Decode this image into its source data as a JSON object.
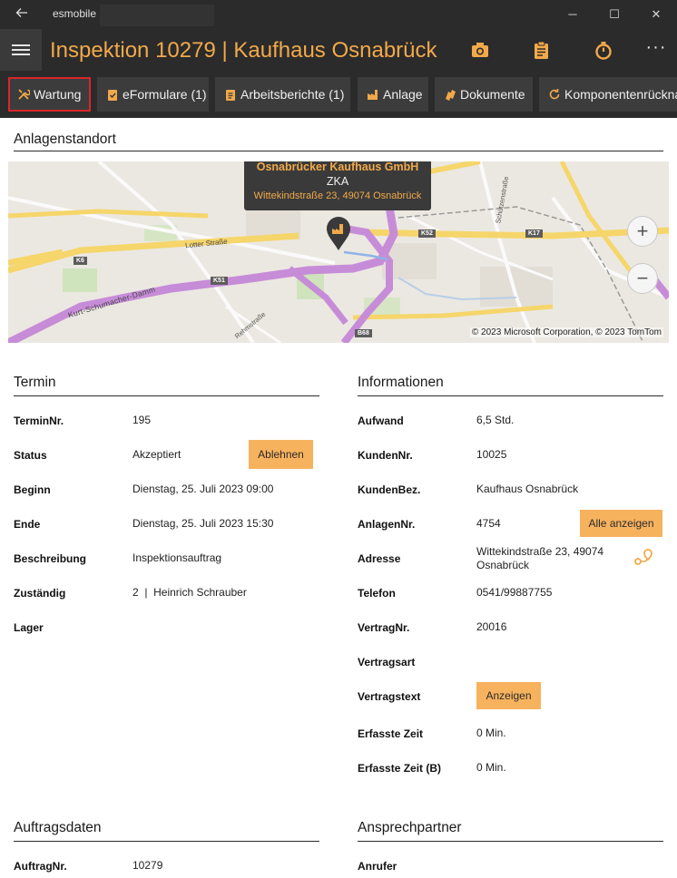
{
  "window": {
    "app_name": "esmobile",
    "back_icon": "back-arrow-icon",
    "minimize": "─",
    "maximize": "☐",
    "close": "✕"
  },
  "appbar": {
    "title": "Inspektion 10279  |  Kaufhaus Osnabrück",
    "icons": [
      "camera-icon",
      "clipboard-icon",
      "stopwatch-icon",
      "more-icon"
    ],
    "more_label": "···",
    "accent": "#f2a94a"
  },
  "toolbar": {
    "tabs": [
      {
        "label": "Wartung",
        "icon": "wrench-icon",
        "active": true
      },
      {
        "label": "eFormulare (1)",
        "icon": "clipboard-check-icon"
      },
      {
        "label": "Arbeitsberichte (1)",
        "icon": "clipboard-icon"
      },
      {
        "label": "Anlage",
        "icon": "factory-icon"
      },
      {
        "label": "Dokumente",
        "icon": "documents-icon"
      },
      {
        "label": "Komponentenrücknahme",
        "icon": "refresh-icon"
      }
    ]
  },
  "location": {
    "title": "Anlagenstandort",
    "map": {
      "popup_name": "Osnabrücker Kaufhaus GmbH",
      "popup_type": "ZKA",
      "popup_address": "Wittekindstraße 23, 49074 Osnabrück",
      "copyright": "© 2023 Microsoft Corporation, © 2023 TomTom",
      "zoom_in": "+",
      "zoom_out": "−",
      "roads": [
        "Lotter Straße",
        "Kurt-Schumacher-Damm",
        "Rehmstraße",
        "Schützenstraße"
      ],
      "shields": [
        "K6",
        "K51",
        "K52",
        "K17",
        "B68"
      ]
    }
  },
  "termin": {
    "title": "Termin",
    "rows": [
      {
        "label": "TerminNr.",
        "value": "195"
      },
      {
        "label": "Status",
        "value": "Akzeptiert",
        "button": "Ablehnen"
      },
      {
        "label": "Beginn",
        "value": "Dienstag, 25. Juli 2023 09:00"
      },
      {
        "label": "Ende",
        "value": "Dienstag, 25. Juli 2023 15:30"
      },
      {
        "label": "Beschreibung",
        "value": "Inspektionsauftrag"
      },
      {
        "label": "Zuständig",
        "value": "2  |  Heinrich Schrauber"
      },
      {
        "label": "Lager",
        "value": ""
      }
    ]
  },
  "informationen": {
    "title": "Informationen",
    "rows": [
      {
        "label": "Aufwand",
        "value": "6,5 Std."
      },
      {
        "label": "KundenNr.",
        "value": "10025"
      },
      {
        "label": "KundenBez.",
        "value": "Kaufhaus Osnabrück"
      },
      {
        "label": "AnlagenNr.",
        "value": "4754",
        "button": "Alle anzeigen"
      },
      {
        "label": "Adresse",
        "value_line1": "Wittekindstraße 23, 49074",
        "value_line2": "Osnabrück",
        "icon": "route-icon"
      },
      {
        "label": "Telefon",
        "value": "0541/99887755"
      },
      {
        "label": "VertragNr.",
        "value": "20016"
      },
      {
        "label": "Vertragsart",
        "value": ""
      },
      {
        "label": "Vertragstext",
        "value": "",
        "button": "Anzeigen"
      },
      {
        "label": "Erfasste Zeit",
        "value": "0 Min."
      },
      {
        "label": "Erfasste Zeit (B)",
        "value": "0 Min."
      }
    ]
  },
  "auftragsdaten": {
    "title": "Auftragsdaten",
    "rows": [
      {
        "label": "AuftragNr.",
        "value": "10279"
      }
    ]
  },
  "ansprechpartner": {
    "title": "Ansprechpartner",
    "rows": [
      {
        "label": "Anrufer",
        "value": ""
      }
    ]
  },
  "colors": {
    "dark_bar": "#2b2b2b",
    "button_bg": "#3c3c3c",
    "accent_button": "#f7b25e",
    "active_border": "#d9262b"
  }
}
